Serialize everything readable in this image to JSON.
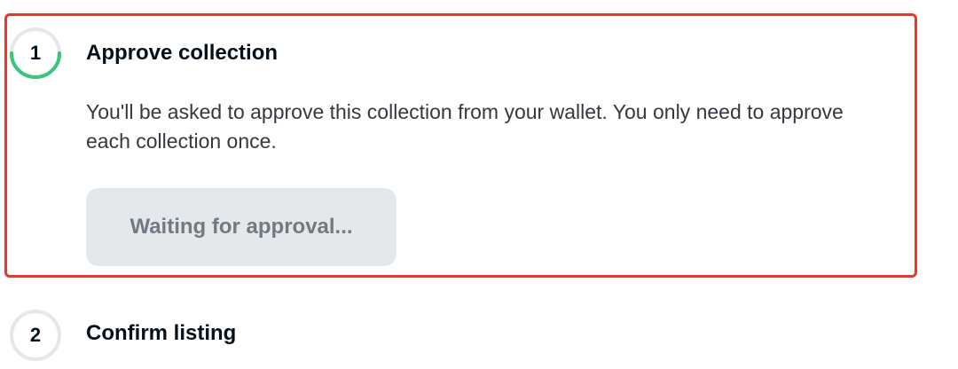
{
  "steps": [
    {
      "number": "1",
      "title": "Approve collection",
      "description": "You'll be asked to approve this collection from your wallet. You only need to approve each collection once.",
      "button_label": "Waiting for approval...",
      "status": "in-progress"
    },
    {
      "number": "2",
      "title": "Confirm listing",
      "status": "pending"
    }
  ],
  "colors": {
    "highlight_border": "#e23b2e",
    "progress_green": "#34c77b",
    "ring_gray": "#e5e8eb",
    "button_bg": "#e5e8eb",
    "button_text": "#707a83"
  }
}
